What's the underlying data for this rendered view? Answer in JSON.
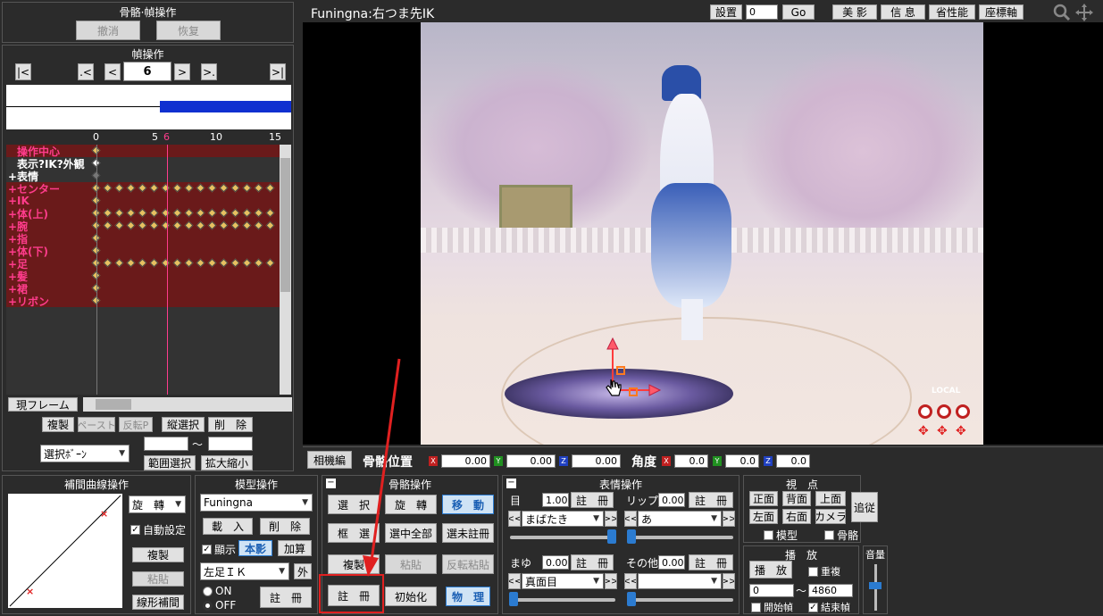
{
  "bone_frame_panel": {
    "title": "骨骼·幀操作",
    "undo": "撤消",
    "redo": "恢复"
  },
  "frame_panel": {
    "title": "幀操作",
    "first": "|<",
    "prev_key": ".<",
    "prev": "<",
    "frame_value": "6",
    "next": ">",
    "next_key": ">.",
    "last": ">|",
    "ruler_ticks": [
      "0",
      "5",
      "6",
      "10",
      "15"
    ],
    "tracks": [
      {
        "label": "操作中心",
        "color": "#ff3c8c",
        "prefix": ""
      },
      {
        "label": "表示?IK?外観",
        "color": "#ffffff",
        "prefix": ""
      },
      {
        "label": "表情",
        "color": "#ffffff",
        "prefix": "+"
      },
      {
        "label": "センター",
        "color": "#ff3c8c",
        "prefix": "+"
      },
      {
        "label": "IK",
        "color": "#ff3c8c",
        "prefix": "+"
      },
      {
        "label": "体(上)",
        "color": "#ff3c8c",
        "prefix": "+"
      },
      {
        "label": "腕",
        "color": "#ff3c8c",
        "prefix": "+"
      },
      {
        "label": "指",
        "color": "#ff3c8c",
        "prefix": "+"
      },
      {
        "label": "体(下)",
        "color": "#ff3c8c",
        "prefix": "+"
      },
      {
        "label": "足",
        "color": "#ff3c8c",
        "prefix": "+"
      },
      {
        "label": "髪",
        "color": "#ff3c8c",
        "prefix": "+"
      },
      {
        "label": "裙",
        "color": "#ff3c8c",
        "prefix": "+"
      },
      {
        "label": "リボン",
        "color": "#ff3c8c",
        "prefix": "+"
      }
    ],
    "current_frame_btn": "現フレーム",
    "copy": "複製",
    "paste": "ペースト",
    "paste_reverse": "反転P",
    "vertical_select": "縦選択",
    "delete": "削　除",
    "select_bone": "選択ﾎﾞｰﾝ",
    "range_from": "",
    "range_sep": "～",
    "range_to": "",
    "range_select": "範囲選択",
    "scale": "拡大縮小"
  },
  "viewport": {
    "title": "Funingna:右つま先IK",
    "settings": "設置",
    "frame_input": "0",
    "go": "Go",
    "beauty": "美 影",
    "info": "信 息",
    "perf": "省性能",
    "axis": "座標軸",
    "local_label": "LOCAL"
  },
  "bone_bar": {
    "camera_edit": "相機編",
    "position_label": "骨骼位置",
    "x_pos": "0.00",
    "y_pos": "0.00",
    "z_pos": "0.00",
    "angle_label": "角度",
    "x_ang": "0.0",
    "y_ang": "0.0",
    "z_ang": "0.0"
  },
  "interp_panel": {
    "title": "補間曲線操作",
    "rotate_select": "旋　轉",
    "auto_set": "自動設定",
    "copy": "複製",
    "paste": "粘貼",
    "linear": "線形補間"
  },
  "model_panel": {
    "title": "模型操作",
    "model_select": "Funingna",
    "load": "載　入",
    "delete": "削　除",
    "display": "顯示",
    "shadow": "本影",
    "add": "加算",
    "bone_select": "左足ＩＫ",
    "outer": "外",
    "on": "ON",
    "off": "OFF",
    "register": "註　冊"
  },
  "bone_panel": {
    "title": "骨骼操作",
    "select": "選　択",
    "rotate": "旋　轉",
    "move": "移　動",
    "frame_select": "框　選",
    "select_all": "選中全部",
    "select_unreg": "選未註冊",
    "copy": "複製",
    "paste": "粘貼",
    "paste_reverse": "反転粘貼",
    "register": "註　冊",
    "initialize": "初始化",
    "physics": "物　理"
  },
  "expression_panel": {
    "title": "表情操作",
    "eye_label": "目",
    "eye_value": "1.000",
    "eye_register": "註　冊",
    "eye_select": "まばたき",
    "lip_label": "リップ",
    "lip_value": "0.000",
    "lip_register": "註　冊",
    "lip_select": "あ",
    "brow_label": "まゆ",
    "brow_value": "0.000",
    "brow_register": "註　冊",
    "brow_select": "真面目",
    "other_label": "その他",
    "other_value": "0.000",
    "other_register": "註　冊",
    "other_select": "",
    "prev": "<<",
    "next": ">>"
  },
  "view_panel": {
    "title": "視　点",
    "front": "正面",
    "back": "背面",
    "top": "上面",
    "left": "左面",
    "right": "右面",
    "camera": "カメラ",
    "follow": "追従",
    "model": "模型",
    "bone": "骨骼"
  },
  "play_panel": {
    "title": "播　放",
    "play": "播　放",
    "repeat": "重複",
    "start": "0",
    "sep": "～",
    "end": "4860",
    "start_frame": "開始幀",
    "end_frame": "結束幀"
  },
  "volume_panel": {
    "title": "音量"
  },
  "colors": {
    "accent_pink": "#ff3c8c",
    "key_color": "#e8c060",
    "track_bg": "#5a1a1a",
    "blue_accent": "#2b7bd0",
    "annotation_red": "#e02020"
  }
}
